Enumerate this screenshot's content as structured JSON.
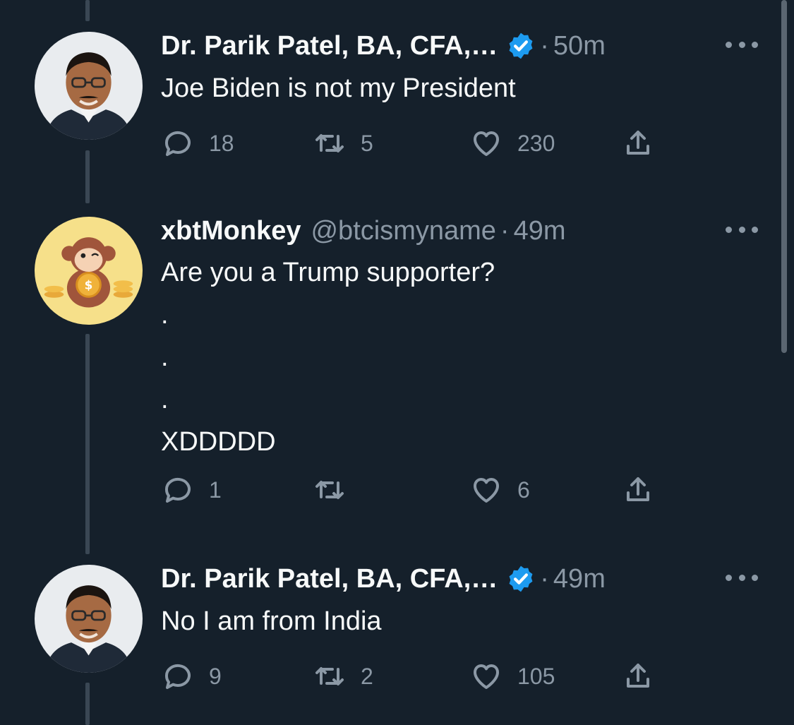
{
  "tweets": [
    {
      "name": "Dr. Parik Patel, BA, CFA,…",
      "verified": true,
      "handle": "",
      "time": "50m",
      "text": "Joe Biden is not my President",
      "replies": "18",
      "retweets": "5",
      "likes": "230"
    },
    {
      "name": "xbtMonkey",
      "verified": false,
      "handle": "@btcismyname",
      "time": "49m",
      "text": "Are you a Trump supporter?\n.\n.\n.\nXDDDDD",
      "replies": "1",
      "retweets": "",
      "likes": "6"
    },
    {
      "name": "Dr. Parik Patel, BA, CFA,…",
      "verified": true,
      "handle": "",
      "time": "49m",
      "text": "No I am from India",
      "replies": "9",
      "retweets": "2",
      "likes": "105"
    }
  ],
  "separator": "·",
  "icons": {
    "reply": "reply-icon",
    "retweet": "retweet-icon",
    "like": "like-icon",
    "share": "share-icon",
    "verified": "verified-badge-icon",
    "more": "more-options-icon"
  },
  "colors": {
    "background": "#15202b",
    "text": "#f7f9f9",
    "muted": "#8b98a5",
    "verified": "#1d9bf0",
    "thread_line": "#3a4754"
  }
}
